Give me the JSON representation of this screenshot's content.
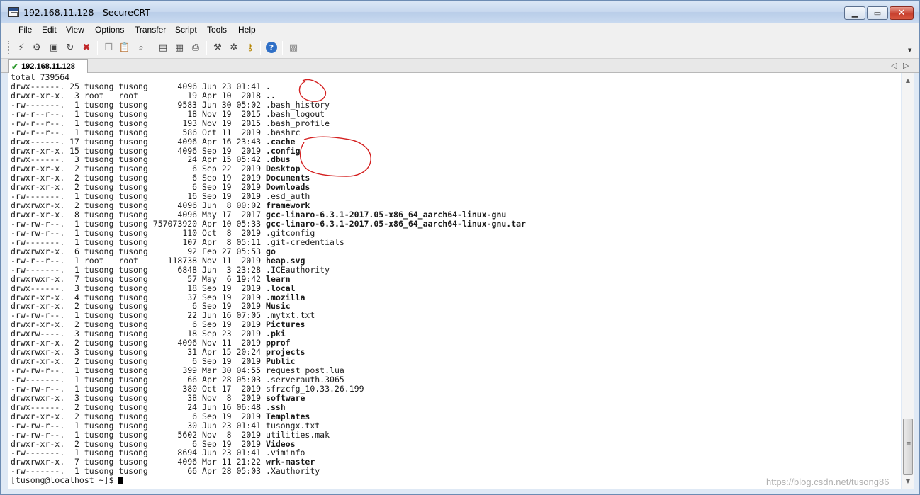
{
  "window": {
    "title": "192.168.11.128 - SecureCRT"
  },
  "menu": [
    "File",
    "Edit",
    "View",
    "Options",
    "Transfer",
    "Script",
    "Tools",
    "Help"
  ],
  "tab": {
    "label": "192.168.11.128"
  },
  "terminal": {
    "lines": [
      {
        "text": "total 739564",
        "bold": ""
      },
      {
        "text": "drwx------. 25 tusong tusong      4096 Jun 23 01:41 ",
        "bold": "."
      },
      {
        "text": "drwxr-xr-x.  3 root   root          19 Apr 10  2018 ",
        "bold": ".."
      },
      {
        "text": "-rw-------.  1 tusong tusong      9583 Jun 30 05:02 .bash_history",
        "bold": ""
      },
      {
        "text": "-rw-r--r--.  1 tusong tusong        18 Nov 19  2015 .bash_logout",
        "bold": ""
      },
      {
        "text": "-rw-r--r--.  1 tusong tusong       193 Nov 19  2015 .bash_profile",
        "bold": ""
      },
      {
        "text": "-rw-r--r--.  1 tusong tusong       586 Oct 11  2019 .bashrc",
        "bold": ""
      },
      {
        "text": "drwx------. 17 tusong tusong      4096 Apr 16 23:43 ",
        "bold": ".cache"
      },
      {
        "text": "drwxr-xr-x. 15 tusong tusong      4096 Sep 19  2019 ",
        "bold": ".config"
      },
      {
        "text": "drwx------.  3 tusong tusong        24 Apr 15 05:42 ",
        "bold": ".dbus"
      },
      {
        "text": "drwxr-xr-x.  2 tusong tusong         6 Sep 22  2019 ",
        "bold": "Desktop"
      },
      {
        "text": "drwxr-xr-x.  2 tusong tusong         6 Sep 19  2019 ",
        "bold": "Documents"
      },
      {
        "text": "drwxr-xr-x.  2 tusong tusong         6 Sep 19  2019 ",
        "bold": "Downloads"
      },
      {
        "text": "-rw-------.  1 tusong tusong        16 Sep 19  2019 .esd_auth",
        "bold": ""
      },
      {
        "text": "drwxrwxr-x.  2 tusong tusong      4096 Jun  8 00:02 ",
        "bold": "framework"
      },
      {
        "text": "drwxr-xr-x.  8 tusong tusong      4096 May 17  2017 ",
        "bold": "gcc-linaro-6.3.1-2017.05-x86_64_aarch64-linux-gnu"
      },
      {
        "text": "-rw-rw-r--.  1 tusong tusong 757073920 Apr 10 05:33 ",
        "bold": "gcc-linaro-6.3.1-2017.05-x86_64_aarch64-linux-gnu.tar"
      },
      {
        "text": "-rw-rw-r--.  1 tusong tusong       110 Oct  8  2019 .gitconfig",
        "bold": ""
      },
      {
        "text": "-rw-------.  1 tusong tusong       107 Apr  8 05:11 .git-credentials",
        "bold": ""
      },
      {
        "text": "drwxrwxr-x.  6 tusong tusong        92 Feb 27 05:53 ",
        "bold": "go"
      },
      {
        "text": "-rw-r--r--.  1 root   root      118738 Nov 11  2019 ",
        "bold": "heap.svg"
      },
      {
        "text": "-rw-------.  1 tusong tusong      6848 Jun  3 23:28 .ICEauthority",
        "bold": ""
      },
      {
        "text": "drwxrwxr-x.  7 tusong tusong        57 May  6 19:42 ",
        "bold": "learn"
      },
      {
        "text": "drwx------.  3 tusong tusong        18 Sep 19  2019 ",
        "bold": ".local"
      },
      {
        "text": "drwxr-xr-x.  4 tusong tusong        37 Sep 19  2019 ",
        "bold": ".mozilla"
      },
      {
        "text": "drwxr-xr-x.  2 tusong tusong         6 Sep 19  2019 ",
        "bold": "Music"
      },
      {
        "text": "-rw-rw-r--.  1 tusong tusong        22 Jun 16 07:05 .mytxt.txt",
        "bold": ""
      },
      {
        "text": "drwxr-xr-x.  2 tusong tusong         6 Sep 19  2019 ",
        "bold": "Pictures"
      },
      {
        "text": "drwxrw----.  3 tusong tusong        18 Sep 23  2019 ",
        "bold": ".pki"
      },
      {
        "text": "drwxr-xr-x.  2 tusong tusong      4096 Nov 11  2019 ",
        "bold": "pprof"
      },
      {
        "text": "drwxrwxr-x.  3 tusong tusong        31 Apr 15 20:24 ",
        "bold": "projects"
      },
      {
        "text": "drwxr-xr-x.  2 tusong tusong         6 Sep 19  2019 ",
        "bold": "Public"
      },
      {
        "text": "-rw-rw-r--.  1 tusong tusong       399 Mar 30 04:55 request_post.lua",
        "bold": ""
      },
      {
        "text": "-rw-------.  1 tusong tusong        66 Apr 28 05:03 .serverauth.3065",
        "bold": ""
      },
      {
        "text": "-rw-rw-r--.  1 tusong tusong       380 Oct 17  2019 sfrzcfg_10.33.26.199",
        "bold": ""
      },
      {
        "text": "drwxrwxr-x.  3 tusong tusong        38 Nov  8  2019 ",
        "bold": "software"
      },
      {
        "text": "drwx------.  2 tusong tusong        24 Jun 16 06:48 ",
        "bold": ".ssh"
      },
      {
        "text": "drwxr-xr-x.  2 tusong tusong         6 Sep 19  2019 ",
        "bold": "Templates"
      },
      {
        "text": "-rw-rw-r--.  1 tusong tusong        30 Jun 23 01:41 tusongx.txt",
        "bold": ""
      },
      {
        "text": "-rw-rw-r--.  1 tusong tusong      5602 Nov  8  2019 utilities.mak",
        "bold": ""
      },
      {
        "text": "drwxr-xr-x.  2 tusong tusong         6 Sep 19  2019 ",
        "bold": "Videos"
      },
      {
        "text": "-rw-------.  1 tusong tusong      8694 Jun 23 01:41 .viminfo",
        "bold": ""
      },
      {
        "text": "drwxrwxr-x.  7 tusong tusong      4096 Mar 11 21:22 ",
        "bold": "wrk-master"
      },
      {
        "text": "-rw-------.  1 tusong tusong        66 Apr 28 05:03 .Xauthority",
        "bold": ""
      }
    ],
    "prompt": "[tusong@localhost ~]$ "
  },
  "watermark": "https://blog.csdn.net/tusong86",
  "colors": {
    "annotation": "#d42020",
    "titlebar": "#c7d8ee",
    "close_button": "#c8412f"
  }
}
